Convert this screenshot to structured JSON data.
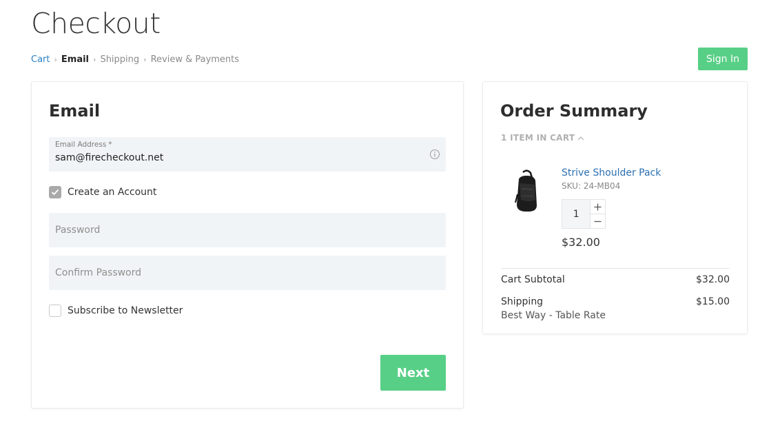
{
  "page": {
    "title": "Checkout"
  },
  "breadcrumb": {
    "items": [
      {
        "label": "Cart"
      },
      {
        "label": "Email"
      },
      {
        "label": "Shipping"
      },
      {
        "label": "Review & Payments"
      }
    ],
    "separator": "›"
  },
  "header": {
    "signin_label": "Sign In"
  },
  "email_section": {
    "title": "Email",
    "email_field": {
      "label": "Email Address",
      "required_mark": "*",
      "value": "sam@firecheckout.net",
      "icon": "info-icon"
    },
    "create_account": {
      "label": "Create an Account",
      "checked": true
    },
    "password_field": {
      "placeholder": "Password"
    },
    "confirm_password_field": {
      "placeholder": "Confirm Password"
    },
    "newsletter": {
      "label": "Subscribe to Newsletter",
      "checked": false
    },
    "next_label": "Next"
  },
  "summary": {
    "title": "Order Summary",
    "items_toggle": "1 ITEM IN CART",
    "item": {
      "name": "Strive Shoulder Pack",
      "sku": "SKU: 24-MB04",
      "quantity": "1",
      "price": "$32.00",
      "image": "backpack-image"
    },
    "totals": {
      "subtotal_label": "Cart Subtotal",
      "subtotal_value": "$32.00",
      "shipping_label": "Shipping",
      "shipping_value": "$15.00",
      "shipping_method": "Best Way - Table Rate"
    }
  },
  "colors": {
    "accent": "#58cf86",
    "link": "#2b6fb0",
    "field_bg": "#f1f4f6"
  }
}
